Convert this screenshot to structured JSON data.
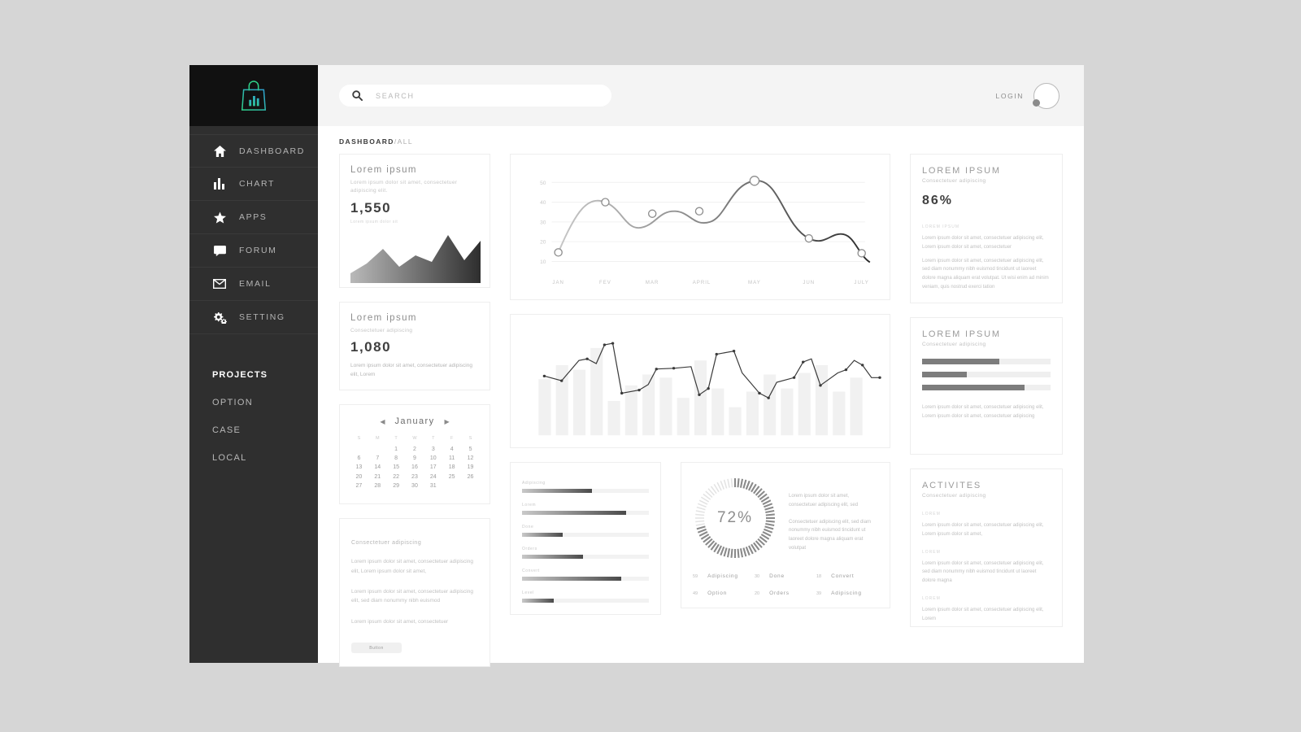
{
  "brand": {
    "logo_icon": "shopping-bag-chart-logo",
    "accent": "#3ddc97",
    "accent2": "#2aa0d8"
  },
  "sidebar": {
    "nav": [
      {
        "label": "DASHBOARD",
        "icon": "home-icon"
      },
      {
        "label": "CHART",
        "icon": "bar-chart-icon"
      },
      {
        "label": "APPS",
        "icon": "star-icon"
      },
      {
        "label": "FORUM",
        "icon": "chat-bubble-icon"
      },
      {
        "label": "EMAIL",
        "icon": "envelope-icon"
      },
      {
        "label": "SETTING",
        "icon": "gears-icon"
      }
    ],
    "projects_title": "PROJECTS",
    "projects": [
      {
        "label": "OPTION"
      },
      {
        "label": "CASE"
      },
      {
        "label": "LOCAL"
      }
    ]
  },
  "topbar": {
    "search_placeholder": "SEARCH",
    "search_value": "",
    "search_icon": "search-icon",
    "login_label": "LOGIN",
    "avatar": "user-avatar"
  },
  "breadcrumb": {
    "current": "DASHBOARD",
    "separator": "/",
    "scope": "ALL"
  },
  "cards": {
    "stat1": {
      "title": "Lorem ipsum",
      "subtitle": "Lorem ipsum dolor sit amet, consectetuer adipiscing elit.",
      "value": "1,550",
      "caption": "Lorem ipsum dolor sit"
    },
    "stat2": {
      "title": "Lorem ipsum",
      "subtitle": "Consectetuer adipiscing",
      "value": "1,080",
      "body": "Lorem ipsum dolor sit amet, consectetuer adipiscing elit, Lorem"
    },
    "calendar": {
      "month": "January",
      "prev_icon": "chevron-left-icon",
      "next_icon": "chevron-right-icon",
      "weekdays": [
        "S",
        "M",
        "T",
        "W",
        "T",
        "F",
        "S"
      ],
      "weeks": [
        [
          "",
          "",
          "1",
          "2",
          "3",
          "4",
          "5"
        ],
        [
          "6",
          "7",
          "8",
          "9",
          "10",
          "11",
          "12"
        ],
        [
          "13",
          "14",
          "15",
          "16",
          "17",
          "18",
          "19"
        ],
        [
          "20",
          "21",
          "22",
          "23",
          "24",
          "25",
          "26"
        ],
        [
          "27",
          "28",
          "29",
          "30",
          "31",
          "",
          ""
        ]
      ]
    },
    "percent_card": {
      "title": "LOREM IPSUM",
      "subtitle": "Consectetuer adipiscing",
      "value": "86%",
      "section_label": "LOREM IPSUM",
      "para1": "Lorem ipsum dolor sit amet, consectetuer adipiscing elit, Lorem ipsum dolor sit amet, consectetuer",
      "para2": "Lorem ipsum dolor sit amet, consectetuer adipiscing elit, sed diam nonummy nibh euismod tincidunt ut laoreet dolore magna aliquam erat volutpat. Ut wisi enim ad minim veniam, quis nostrud exerci tation"
    },
    "bars_card": {
      "title": "LOREM IPSUM",
      "subtitle": "Consectetuer adipiscing",
      "bars": [
        60,
        35,
        80
      ],
      "para": "Lorem ipsum dolor sit amet, consectetuer adipiscing elit, Lorem ipsum dolor sit amet, consectetuer adipiscing"
    },
    "text_card": {
      "head": "Consectetuer adipiscing",
      "para1": "Lorem ipsum dolor sit amet, consectetuer adipiscing elit, Lorem ipsum dolor sit amet,",
      "para2": "Lorem ipsum dolor sit amet, consectetuer adipiscing elit, sed diam nonummy nibh euismod",
      "para3": "Lorem ipsum dolor sit amet, consectetuer",
      "button": "Button"
    },
    "activities": {
      "title": "ACTIVITES",
      "subtitle": "Consectetuer adipiscing",
      "items": [
        {
          "label": "LOREM",
          "text": "Lorem ipsum dolor sit amet, consectetuer adipiscing elit, Lorem ipsum dolor sit amet,"
        },
        {
          "label": "LOREM",
          "text": "Lorem ipsum dolor sit amet, consectetuer adipiscing elit, sed diam nonummy nibh euismod tincidunt ut laoreet dolore magna"
        },
        {
          "label": "LOREM",
          "text": "Lorem ipsum dolor sit amet, consectetuer adipiscing elit, Lorem"
        }
      ]
    },
    "donut_card": {
      "value": "72%",
      "para1": "Lorem ipsum dolor sit amet, consectetuer adipiscing elit, sed",
      "para2": "Consectetuer adipiscing elit, sed diam nonummy nibh euismod tincidunt ut laoreet dolore magna aliquam erat volutpat",
      "legend": [
        {
          "num": "59",
          "name": "Adipiscing"
        },
        {
          "num": "30",
          "name": "Done"
        },
        {
          "num": "18",
          "name": "Convert"
        },
        {
          "num": "49",
          "name": "Option"
        },
        {
          "num": "20",
          "name": "Orders"
        },
        {
          "num": "39",
          "name": "Adipiscing"
        }
      ]
    }
  },
  "chart_data": [
    {
      "type": "area",
      "name": "stat-card-1-area",
      "title": "",
      "x": [
        0,
        1,
        2,
        3,
        4,
        5,
        6,
        7
      ],
      "values": [
        18,
        30,
        52,
        28,
        44,
        34,
        80,
        46,
        72
      ],
      "ylim": [
        0,
        100
      ],
      "grid": false
    },
    {
      "type": "line",
      "name": "monthly-trend-line",
      "title": "",
      "xlabel": "",
      "ylabel": "",
      "categories": [
        "JAN",
        "FEV",
        "MAR",
        "APRIL",
        "MAY",
        "JUN",
        "JULY"
      ],
      "values": [
        16,
        35,
        32,
        33,
        49,
        27,
        20
      ],
      "yticks": [
        "10",
        "20",
        "30",
        "40",
        "50"
      ],
      "ylim": [
        10,
        55
      ],
      "grid": true,
      "markers": true
    },
    {
      "type": "bar",
      "name": "combo-bar-line",
      "title": "",
      "categories": [
        "1",
        "2",
        "3",
        "4",
        "5",
        "6",
        "7",
        "8",
        "9",
        "10",
        "11",
        "12",
        "13",
        "14",
        "15",
        "16",
        "17",
        "18",
        "19",
        "20"
      ],
      "series": [
        {
          "name": "bars",
          "values": [
            52,
            62,
            58,
            82,
            28,
            46,
            58,
            54,
            32,
            70,
            40,
            22,
            38,
            56,
            42,
            50,
            58,
            34,
            46,
            0
          ]
        },
        {
          "name": "line",
          "values": [
            56,
            54,
            68,
            70,
            46,
            48,
            50,
            66,
            66,
            44,
            42,
            52,
            38,
            78,
            78,
            60,
            48,
            66,
            60,
            54
          ]
        }
      ],
      "ylim": [
        0,
        100
      ],
      "grid": false
    },
    {
      "type": "pie",
      "name": "progress-donut",
      "title": "",
      "values": [
        72,
        28
      ],
      "labels": [
        "complete",
        "remaining"
      ],
      "center_label": "72%"
    },
    {
      "type": "bar",
      "name": "horizontal-progress-right",
      "categories": [
        "bar1",
        "bar2",
        "bar3"
      ],
      "values": [
        60,
        35,
        80
      ],
      "ylim": [
        0,
        100
      ],
      "orientation": "horizontal"
    },
    {
      "type": "bar",
      "name": "bottom-progress-list",
      "orientation": "horizontal",
      "categories": [
        "Adipiscing",
        "Lorem",
        "Done",
        "Orders",
        "Convert",
        "Level"
      ],
      "values": [
        55,
        82,
        32,
        48,
        78,
        25
      ],
      "ylim": [
        0,
        100
      ]
    }
  ]
}
